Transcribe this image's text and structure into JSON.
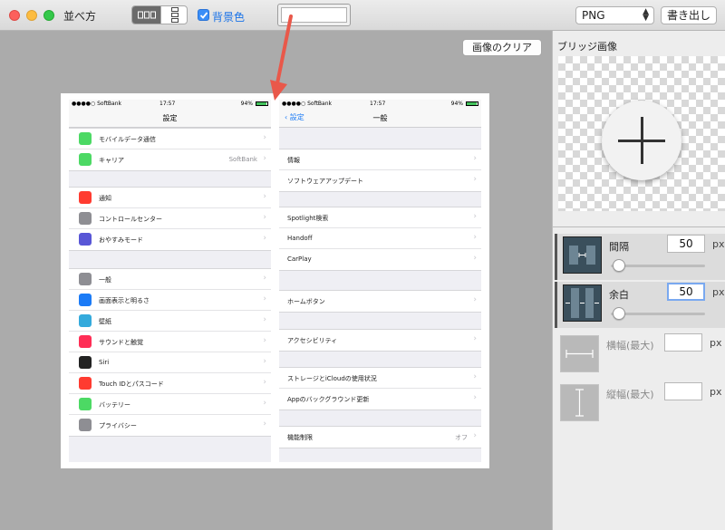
{
  "window": {
    "title": "並べ方"
  },
  "toolbar": {
    "layout_horizontal_icon": "side-by-side-layout-icon",
    "layout_vertical_icon": "stacked-layout-icon",
    "background_color_label": "背景色",
    "background_color_checked": true,
    "format_selected": "PNG",
    "export_label": "書き出し",
    "accent": "#3a8ef7"
  },
  "canvas": {
    "clear_label": "画像のクリア"
  },
  "screenshot_left": {
    "status": {
      "carrier": "●●●●○ SoftBank",
      "time": "17:57",
      "battery": "94%"
    },
    "title": "設定",
    "groups": [
      [
        {
          "label": "モバイルデータ通信",
          "color": "#4cd964"
        },
        {
          "label": "キャリア",
          "detail": "SoftBank",
          "color": "#4cd964"
        }
      ],
      [
        {
          "label": "通知",
          "color": "#ff3b30"
        },
        {
          "label": "コントロールセンター",
          "color": "#8e8e93"
        },
        {
          "label": "おやすみモード",
          "color": "#5856d6"
        }
      ],
      [
        {
          "label": "一般",
          "color": "#8e8e93"
        },
        {
          "label": "画面表示と明るさ",
          "color": "#1b7bf6"
        },
        {
          "label": "壁紙",
          "color": "#34aadc"
        },
        {
          "label": "サウンドと触覚",
          "color": "#ff2d55"
        },
        {
          "label": "Siri",
          "color": "#222222"
        },
        {
          "label": "Touch IDとパスコード",
          "color": "#ff3b30"
        },
        {
          "label": "バッテリー",
          "color": "#4cd964"
        },
        {
          "label": "プライバシー",
          "color": "#8e8e93"
        }
      ]
    ]
  },
  "screenshot_right": {
    "status": {
      "carrier": "●●●●○ SoftBank",
      "time": "17:57",
      "battery": "94%"
    },
    "back_label": "設定",
    "title": "一般",
    "groups": [
      [
        {
          "label": "情報"
        },
        {
          "label": "ソフトウェアアップデート"
        }
      ],
      [
        {
          "label": "Spotlight検索"
        },
        {
          "label": "Handoff"
        },
        {
          "label": "CarPlay"
        }
      ],
      [
        {
          "label": "ホームボタン"
        }
      ],
      [
        {
          "label": "アクセシビリティ"
        }
      ],
      [
        {
          "label": "ストレージとiCloudの使用状況"
        },
        {
          "label": "Appのバックグラウンド更新"
        }
      ],
      [
        {
          "label": "機能制限",
          "detail": "オフ"
        }
      ]
    ]
  },
  "panel": {
    "title": "ブリッジ画像",
    "options": [
      {
        "label": "間隔",
        "value": "50",
        "unit": "px",
        "slider_fraction": 0.07
      },
      {
        "label": "余白",
        "value": "50",
        "unit": "px",
        "slider_fraction": 0.07
      },
      {
        "label": "横幅(最大)",
        "value": "",
        "unit": "px"
      },
      {
        "label": "縦幅(最大)",
        "value": "",
        "unit": "px"
      }
    ]
  }
}
